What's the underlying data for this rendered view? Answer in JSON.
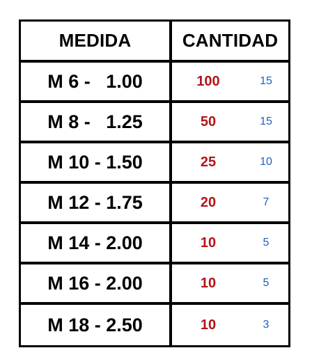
{
  "table": {
    "headers": {
      "medida": "MEDIDA",
      "cantidad": "CANTIDAD"
    },
    "rows": [
      {
        "medida": "M 6 -   1.00",
        "cantidad": "100",
        "extra": "15"
      },
      {
        "medida": "M 8 -   1.25",
        "cantidad": "50",
        "extra": "15"
      },
      {
        "medida": "M 10 - 1.50",
        "cantidad": "25",
        "extra": "10"
      },
      {
        "medida": "M 12 - 1.75",
        "cantidad": "20",
        "extra": "7"
      },
      {
        "medida": "M 14 - 2.00",
        "cantidad": "10",
        "extra": "5"
      },
      {
        "medida": "M 16 - 2.00",
        "cantidad": "10",
        "extra": "5"
      },
      {
        "medida": "M 18 - 2.50",
        "cantidad": "10",
        "extra": "3"
      }
    ]
  },
  "colors": {
    "cantidad": "#b3141a",
    "extra": "#1f5fbf",
    "border": "#000000"
  }
}
